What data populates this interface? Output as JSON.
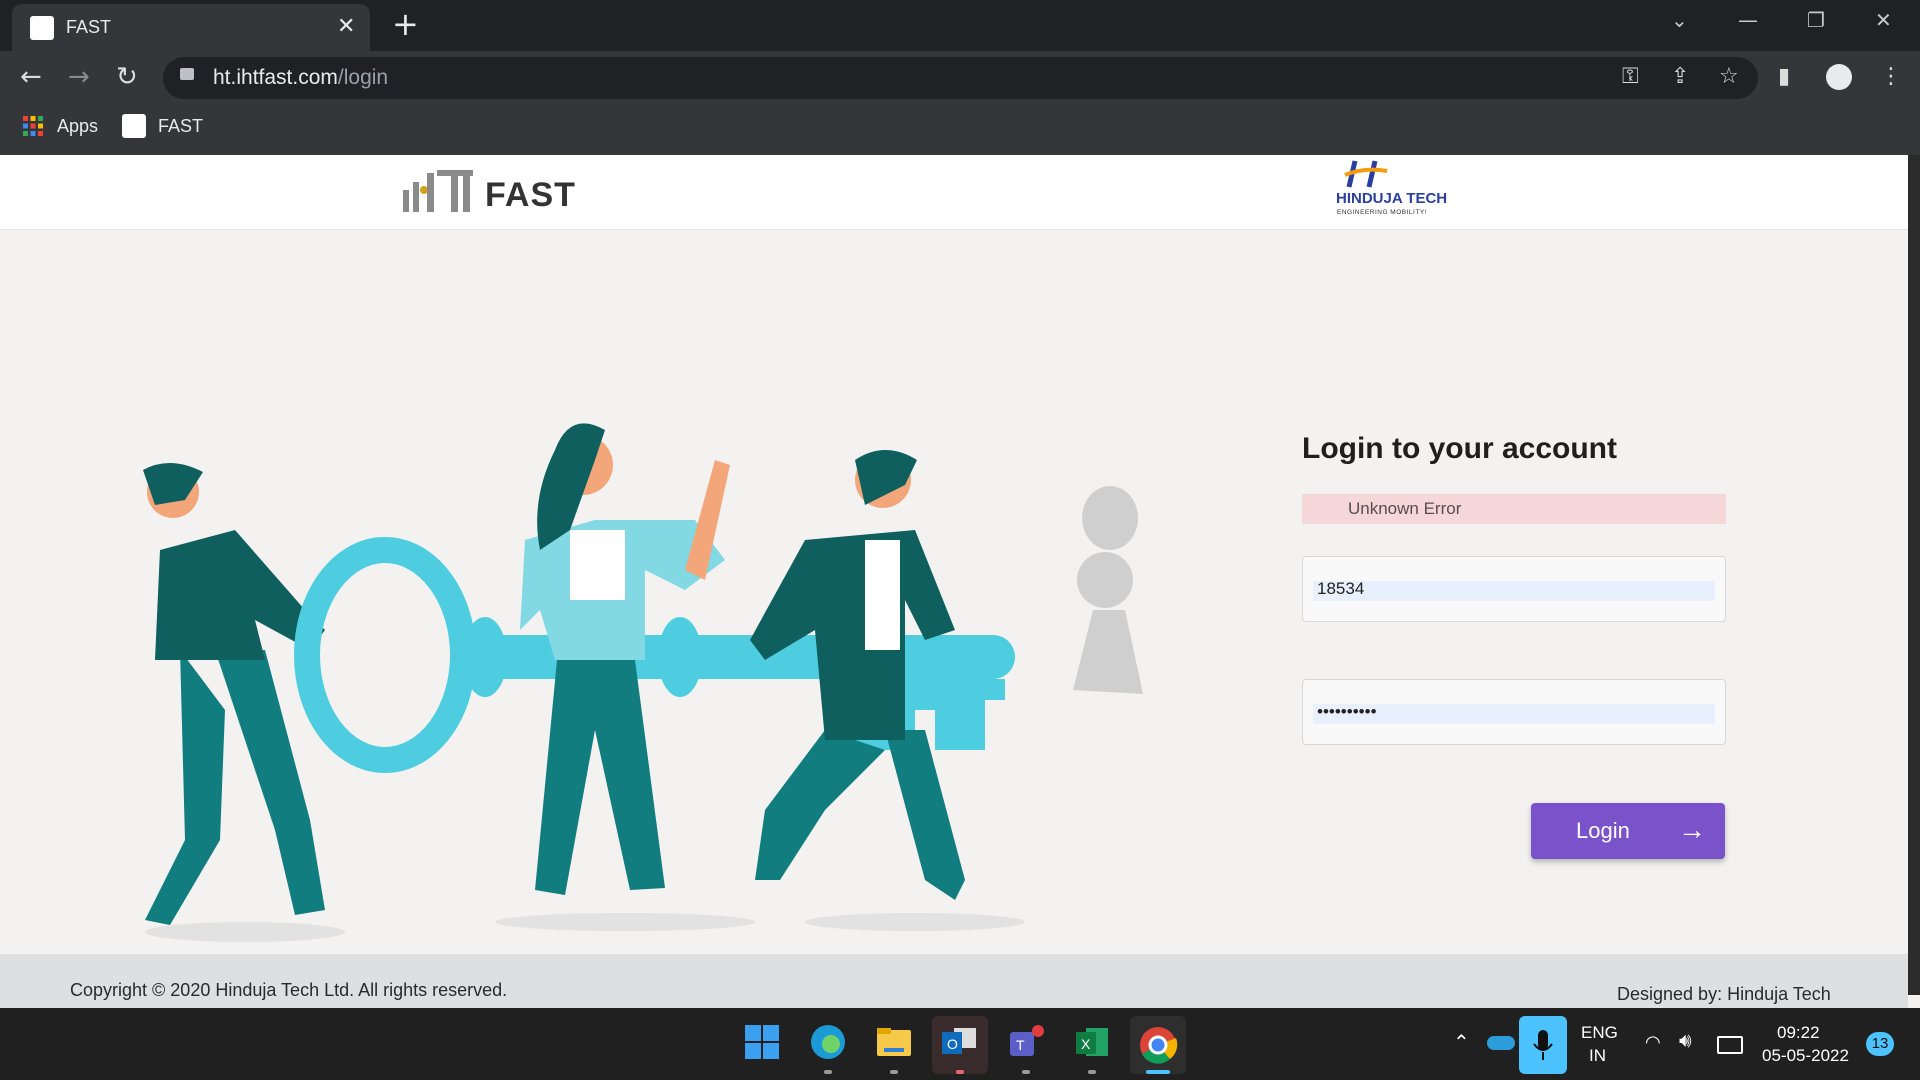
{
  "browser": {
    "tab_title": "FAST",
    "url_host": "ht.ihtfast.com",
    "url_path": "/login",
    "bookmarks": [
      "Apps",
      "FAST"
    ]
  },
  "header": {
    "logo_text": "FAST",
    "partner_name": "HINDUJA TECH",
    "partner_tagline": "ENGINEERING MOBILITY!"
  },
  "login": {
    "title": "Login to your account",
    "error_message": "Unknown Error",
    "username_value": "18534",
    "password_mask": "••••••••••",
    "button_label": "Login",
    "button_arrow": "→"
  },
  "footer": {
    "copyright": "Copyright © 2020 Hinduja Tech Ltd. All rights reserved.",
    "designed_by": "Designed by: Hinduja Tech"
  },
  "taskbar": {
    "language": "ENG",
    "region": "IN",
    "time": "09:22",
    "date": "05-05-2022",
    "notification_count": "13"
  },
  "colors": {
    "accent": "#7a52c9",
    "illustration_teal": "#117d7e",
    "key_cyan": "#4ecde0",
    "error_bg": "#f5d7da"
  }
}
